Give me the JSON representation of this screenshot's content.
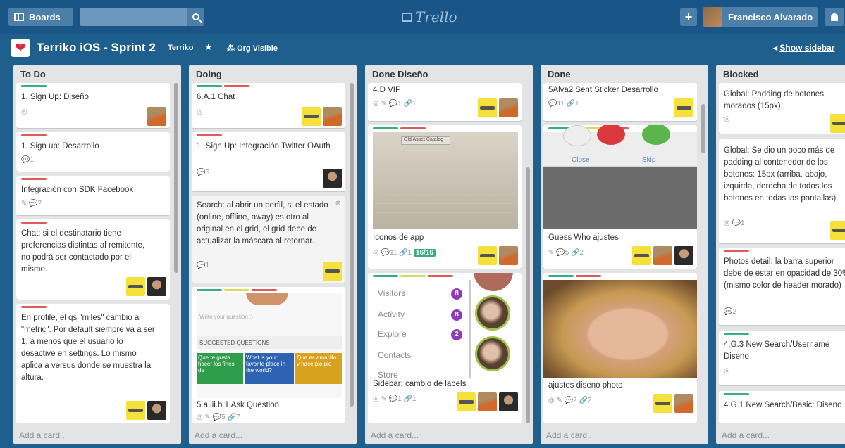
{
  "topbar": {
    "boards_label": "Boards",
    "logo": "Trello",
    "user_name": "Francisco Alvarado"
  },
  "board": {
    "title": "Terriko iOS - Sprint 2",
    "org": "Terriko",
    "visibility": "Org Visible",
    "show_sidebar": "Show sidebar"
  },
  "lists": [
    {
      "title": "To Do",
      "add_card": "Add a card...",
      "cards": [
        {
          "title": "1. Sign Up: Diseño",
          "badges": "◎"
        },
        {
          "title": "1. Sign up: Desarrollo",
          "badges": "💬1"
        },
        {
          "title": "Integración con SDK Facebook",
          "badges": "✎ 💬2"
        },
        {
          "title": "Chat: si el destinatario tiene preferencias distintas al remitente, no podrá ser contactado por el mismo.",
          "badges": ""
        },
        {
          "title": "En profile, el qs \"miles\" cambió a \"metric\". Por default siempre va a ser 1, a menos que el usuario lo desactive en settings. Lo mismo aplica a versus donde se muestra la altura.",
          "badges": ""
        }
      ]
    },
    {
      "title": "Doing",
      "add_card": "Add a card...",
      "cards": [
        {
          "title": "6.A.1 Chat",
          "badges": "◎"
        },
        {
          "title": "1. Sign Up: Integración Twitter OAuth",
          "badges": "💬6"
        },
        {
          "title": "Search: al abrir un perfil, si el estado (online, offline, away) es otro al original en el grid, el grid debe de actualizar la máscara al retornar.",
          "badges": "💬1"
        },
        {
          "title": "5.a.iii.b.1 Ask Question",
          "badges": "◎ ✎ 💬5 🔗7"
        }
      ]
    },
    {
      "title": "Done Diseño",
      "add_card": "Add a card...",
      "cards": [
        {
          "title": "4.D VIP",
          "badges": "◎ ✎ 💬1 🔗1"
        },
        {
          "title": "Iconos de app",
          "badges": "◎ 💬11 🔗1",
          "checklist": "16/16"
        },
        {
          "title": "Sidebar: cambio de labels",
          "badges": "◎ ✎ 💬1 🔗1"
        }
      ]
    },
    {
      "title": "Done",
      "add_card": "Add a card...",
      "cards": [
        {
          "title": "5Alva2 Sent Sticker Desarrollo",
          "badges": "💬11 🔗1"
        },
        {
          "title": "Guess Who ajustes",
          "badges": "✎ 💬5 🔗2"
        },
        {
          "title": "ajustes diseno photo",
          "badges": "◎ ✎ 💬2 🔗2"
        }
      ]
    },
    {
      "title": "Blocked",
      "add_card": "Add a card...",
      "cards": [
        {
          "title": "Global: Padding de botones morados (15px).",
          "badges": "◎"
        },
        {
          "title": "Global: Se dio un poco más de padding al contenedor de los botones: 15px (arriba, abajo, izquirda, derecha de todos los botones en todas las pantallas).",
          "badges": "◎ 💬1"
        },
        {
          "title": "Photos detail: la barra superior debe de estar en opacidad de 30% (mismo color de header morado)",
          "badges": "💬2"
        },
        {
          "title": "4.G.3 New Search/Username Diseno",
          "badges": "◎"
        },
        {
          "title": "4.G.1 New Search/Basic: Diseno",
          "badges": ""
        }
      ]
    }
  ],
  "image_texts": {
    "ask_placeholder": "Write your question :)",
    "suggested": "SUGGESTED QUESTIONS",
    "q1": "Que te gusta hacer los fines de",
    "q2": "What is your favorite place in the world?",
    "q3": "Que es amarillo y hace pio pio",
    "sidebar_visitors": "Visitors",
    "sidebar_activity": "Activity",
    "sidebar_explore": "Explore",
    "sidebar_contacts": "Contacts",
    "sidebar_store": "Store",
    "badge_visitors": "8",
    "badge_activity": "8",
    "badge_explore": "2",
    "close": "Close",
    "skip": "Skip",
    "catalog": "Old Asset Catalog"
  },
  "colors": {
    "board_bg": "#1f5f8e",
    "header_bg": "#1a5587",
    "list_bg": "#e2e4e6",
    "label_green": "#34b27d",
    "label_red": "#e05a5a",
    "label_yellow": "#dbdb57"
  }
}
